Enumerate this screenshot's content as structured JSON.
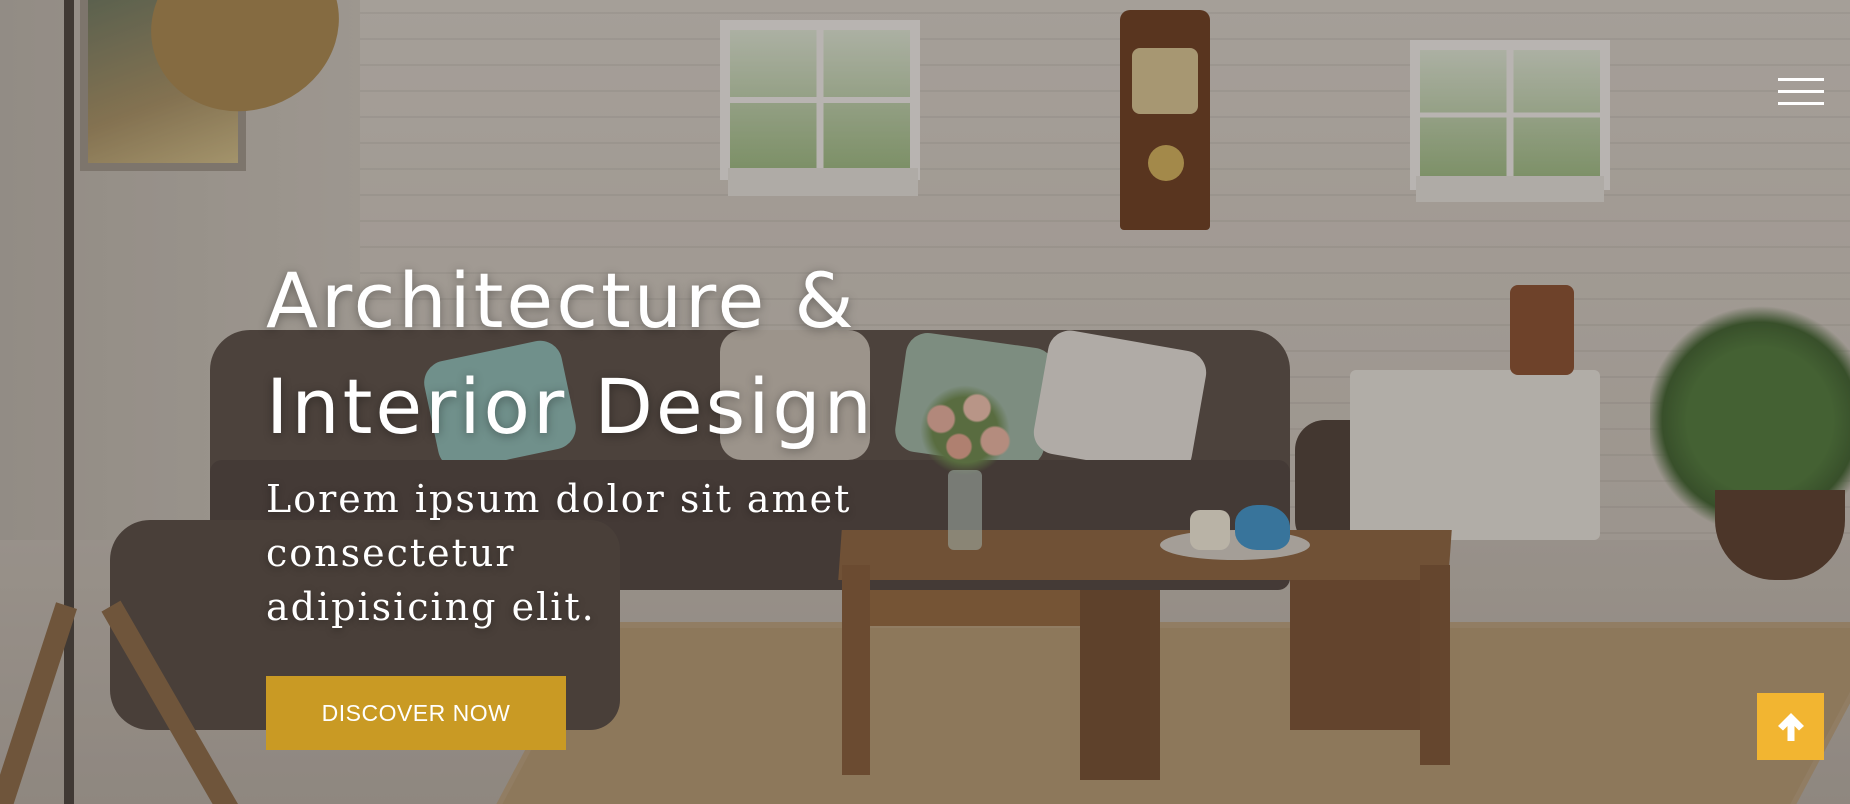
{
  "header": {
    "menu_icon": "hamburger-menu-icon"
  },
  "hero": {
    "title_line1": "Architecture &",
    "title_line2": "Interior Design",
    "subtitle_line1": "Lorem ipsum dolor sit amet consectetur",
    "subtitle_line2": "adipisicing elit.",
    "cta_label": "DISCOVER NOW"
  },
  "scroll_top": {
    "icon": "arrow-up-icon"
  },
  "colors": {
    "accent": "#c99a24",
    "scroll_button": "#f2b531",
    "text": "#ffffff"
  }
}
